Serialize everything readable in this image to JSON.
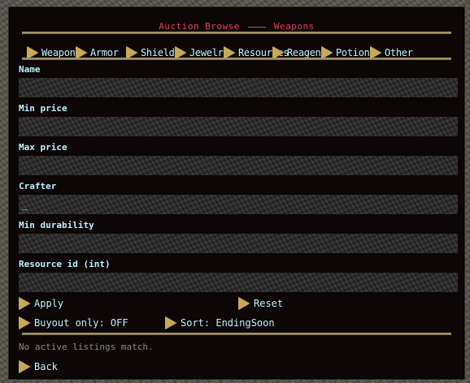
{
  "window": {
    "title_left": "Auction Browse",
    "title_right": "Weapons",
    "accent_color": "#e0405a",
    "text_color": "#bff0ff"
  },
  "tabs": [
    {
      "label": "Weapon",
      "icon": "gold-arrow-icon"
    },
    {
      "label": "Armor",
      "icon": "gold-arrow-icon"
    },
    {
      "label": "Shields",
      "icon": "gold-arrow-icon"
    },
    {
      "label": "Jewelry",
      "icon": "gold-arrow-icon"
    },
    {
      "label": "Resources",
      "icon": "gold-arrow-icon"
    },
    {
      "label": "Reagent",
      "icon": "gold-arrow-icon"
    },
    {
      "label": "Potions",
      "icon": "gold-arrow-icon"
    },
    {
      "label": "Other",
      "icon": "gold-arrow-icon"
    }
  ],
  "fields": {
    "name": {
      "label": "Name",
      "value": ""
    },
    "min_price": {
      "label": "Min price",
      "value": ""
    },
    "max_price": {
      "label": "Max price",
      "value": ""
    },
    "crafter": {
      "label": "Crafter",
      "value": "_"
    },
    "min_durability": {
      "label": "Min durability",
      "value": ""
    },
    "resource_id": {
      "label": "Resource id (int)",
      "value": ""
    }
  },
  "actions": {
    "apply": "Apply",
    "reset": "Reset",
    "buyout_only": "Buyout only: OFF",
    "sort": "Sort: EndingSoon",
    "back": "Back"
  },
  "status": "No active listings match."
}
